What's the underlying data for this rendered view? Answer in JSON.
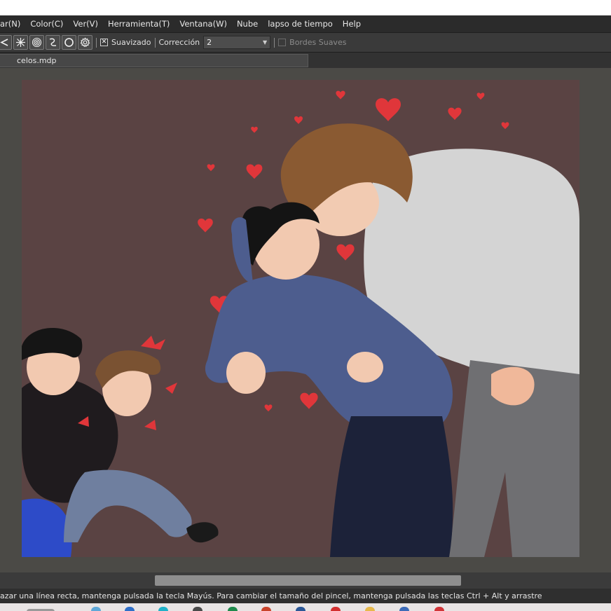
{
  "menu": {
    "items": [
      "ar(N)",
      "Color(C)",
      "Ver(V)",
      "Herramienta(T)",
      "Ventana(W)",
      "Nube",
      "lapso de tiempo",
      "Help"
    ]
  },
  "toolbar": {
    "tool_icons": [
      "ruler-parallel-icon",
      "ruler-radial-icon",
      "ruler-concentric-icon",
      "ruler-curve-icon",
      "ruler-ellipse-icon",
      "ruler-settings-icon"
    ],
    "antialias_label": "Suavizado",
    "antialias_checked": true,
    "correction_label": "Corrección",
    "correction_value": "2",
    "soft_edges_label": "Bordes Suaves",
    "soft_edges_checked": false
  },
  "tabs": [
    {
      "label": "celos.mdp"
    }
  ],
  "status": {
    "text": "azar una línea recta, mantenga pulsada la tecla Mayús. Para cambiar el tamaño del pincel, mantenga pulsada las teclas Ctrl + Alt y arrastre"
  },
  "colors": {
    "menubar_bg": "#2b2b2b",
    "toolbar_bg": "#3a3a3a",
    "workspace_bg": "#4b4a46",
    "canvas_bg": "#5a4343",
    "heart_red": "#e0363a"
  },
  "taskbar": {
    "icons": [
      "search-icon",
      "file-explorer-icon",
      "edge-icon",
      "chrome-icon",
      "store-icon",
      "excel-icon",
      "powerpoint-icon",
      "word-icon",
      "opera-icon",
      "folder-icon",
      "recorder-icon"
    ]
  }
}
